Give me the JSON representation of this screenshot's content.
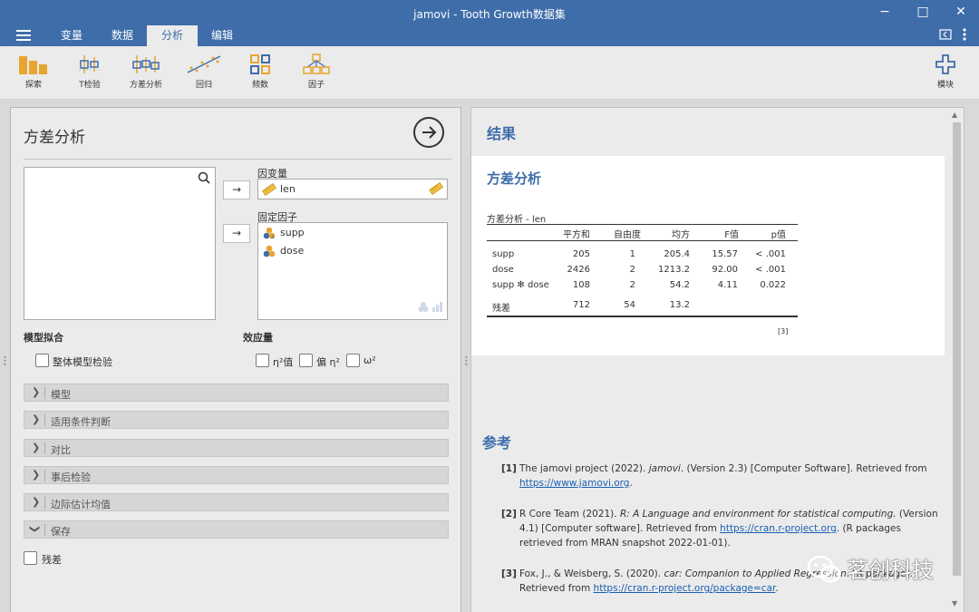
{
  "window": {
    "title": "jamovi - Tooth Growth数据集",
    "minimize": "−",
    "maximize": "□",
    "close": "✕"
  },
  "menu": {
    "tabs": [
      "变量",
      "数据",
      "分析",
      "编辑"
    ],
    "active": "分析"
  },
  "ribbon": {
    "buttons": [
      {
        "label": "探索",
        "icon": "explore-icon"
      },
      {
        "label": "T检验",
        "icon": "t-test-icon"
      },
      {
        "label": "方差分析",
        "icon": "anova-icon"
      },
      {
        "label": "回归",
        "icon": "regression-icon"
      },
      {
        "label": "频数",
        "icon": "frequencies-icon"
      },
      {
        "label": "因子",
        "icon": "factor-icon"
      }
    ],
    "modules_label": "模块"
  },
  "options": {
    "title": "方差分析",
    "dependent_label": "因变量",
    "dependent_value": "len",
    "factors_label": "固定因子",
    "factors": [
      "supp",
      "dose"
    ],
    "arrow_symbol": "→",
    "model_fit_label": "模型拟合",
    "overall_test_label": "整体模型检验",
    "effect_size_label": "效应量",
    "effect_sizes": [
      "η²值",
      "偏 η²",
      "ω²"
    ],
    "sections": [
      "模型",
      "适用条件判断",
      "对比",
      "事后检验",
      "边际估计均值",
      "保存"
    ],
    "residuals_label": "残差"
  },
  "results": {
    "heading": "结果",
    "subheading": "方差分析",
    "table_title": "方差分析 - len",
    "columns": [
      "",
      "平方和",
      "自由度",
      "均方",
      "F值",
      "p值"
    ],
    "rows": [
      [
        "supp",
        "205",
        "1",
        "205.4",
        "15.57",
        "< .001"
      ],
      [
        "dose",
        "2426",
        "2",
        "1213.2",
        "92.00",
        "< .001"
      ],
      [
        "supp ✻ dose",
        "108",
        "2",
        "54.2",
        "4.11",
        "0.022"
      ],
      [
        "残差",
        "712",
        "54",
        "13.2",
        "",
        ""
      ]
    ],
    "note": "[3]"
  },
  "references": {
    "heading": "参考",
    "items": [
      {
        "num": "[1]",
        "pre": "The jamovi project (2022). ",
        "italic": "jamovi",
        "post": ". (Version 2.3) [Computer Software]. Retrieved from ",
        "link": "https://www.jamovi.org",
        "tail": "."
      },
      {
        "num": "[2]",
        "pre": "R Core Team (2021). ",
        "italic": "R: A Language and environment for statistical computing.",
        "post": " (Version 4.1) [Computer software]. Retrieved from ",
        "link": "https://cran.r-project.org",
        "tail": ". (R packages retrieved from MRAN snapshot 2022-01-01)."
      },
      {
        "num": "[3]",
        "pre": "Fox, J., & Weisberg, S. (2020). ",
        "italic": "car: Companion to Applied Regression",
        "post": ". [R package]. Retrieved from ",
        "link": "https://cran.r-project.org/package=car",
        "tail": "."
      }
    ]
  },
  "watermark": {
    "text": "茗创科技"
  },
  "colors": {
    "accent": "#3e6da9",
    "ribbon_icon": "#e8a530",
    "ribbon_icon_blue": "#3e6da9"
  }
}
